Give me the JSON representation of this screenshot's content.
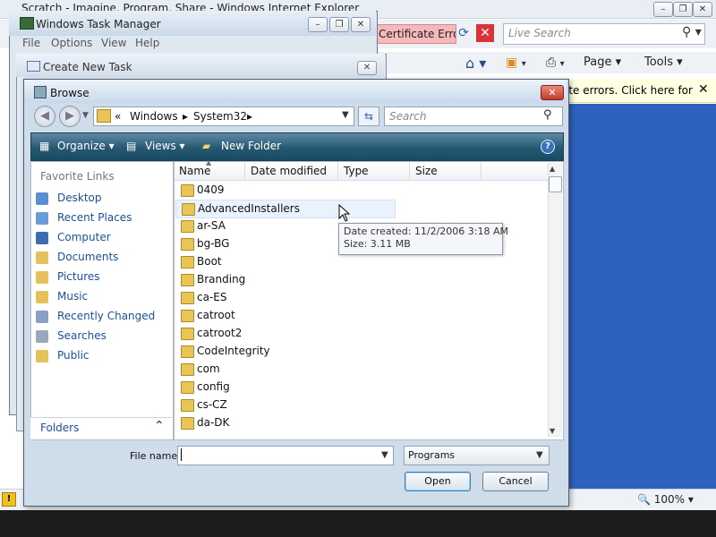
{
  "ie": {
    "title": "Scratch - Imagine, Program, Share - Windows Internet Explorer",
    "controls": [
      "–",
      "❐",
      "✕"
    ],
    "cert_error": "Certificate Error",
    "search_placeholder": "Live Search",
    "commands": {
      "page": "Page ▾",
      "tools": "Tools ▾"
    },
    "info_text": "ate errors. Click here for",
    "zoom": "🔍 100%  ▾"
  },
  "task_manager": {
    "title": "Windows Task Manager",
    "menu": [
      "File",
      "Options",
      "View",
      "Help"
    ],
    "controls": [
      "–",
      "❐",
      "✕"
    ],
    "partial_text": "P"
  },
  "create_task": {
    "title": "Create New Task",
    "close": "✕"
  },
  "browse": {
    "title": "Browse",
    "close": "✕",
    "breadcrumb": [
      "«",
      "Windows",
      "▸",
      "System32",
      "▸"
    ],
    "search_placeholder": "Search",
    "toolbar": {
      "organize": "Organize ▾",
      "views": "Views ▾",
      "new_folder": "New Folder",
      "help": "?"
    },
    "nav": {
      "heading": "Favorite Links",
      "items": [
        {
          "label": "Desktop",
          "icon": "desktop-icon",
          "color": "#5b8fd1"
        },
        {
          "label": "Recent Places",
          "icon": "recent-places-icon",
          "color": "#6a9bd8"
        },
        {
          "label": "Computer",
          "icon": "computer-icon",
          "color": "#3b6cb2"
        },
        {
          "label": "Documents",
          "icon": "documents-icon",
          "color": "#e4c15a"
        },
        {
          "label": "Pictures",
          "icon": "pictures-icon",
          "color": "#e4c15a"
        },
        {
          "label": "Music",
          "icon": "music-icon",
          "color": "#e4c15a"
        },
        {
          "label": "Recently Changed",
          "icon": "recently-changed-icon",
          "color": "#8a9fc4"
        },
        {
          "label": "Searches",
          "icon": "searches-icon",
          "color": "#9aa8b8"
        },
        {
          "label": "Public",
          "icon": "public-icon",
          "color": "#e4c15a"
        }
      ],
      "folders_label": "Folders",
      "folders_caret": "⌃"
    },
    "columns": [
      "Name",
      "Date modified",
      "Type",
      "Size"
    ],
    "files": [
      "0409",
      "AdvancedInstallers",
      "ar-SA",
      "bg-BG",
      "Boot",
      "Branding",
      "ca-ES",
      "catroot",
      "catroot2",
      "CodeIntegrity",
      "com",
      "config",
      "cs-CZ",
      "da-DK"
    ],
    "tooltip": {
      "line1": "Date created: 11/2/2006 3:18 AM",
      "line2": "Size: 3.11 MB"
    },
    "file_name_label": "File name:",
    "file_type": "Programs",
    "open_label": "Open",
    "cancel_label": "Cancel"
  }
}
